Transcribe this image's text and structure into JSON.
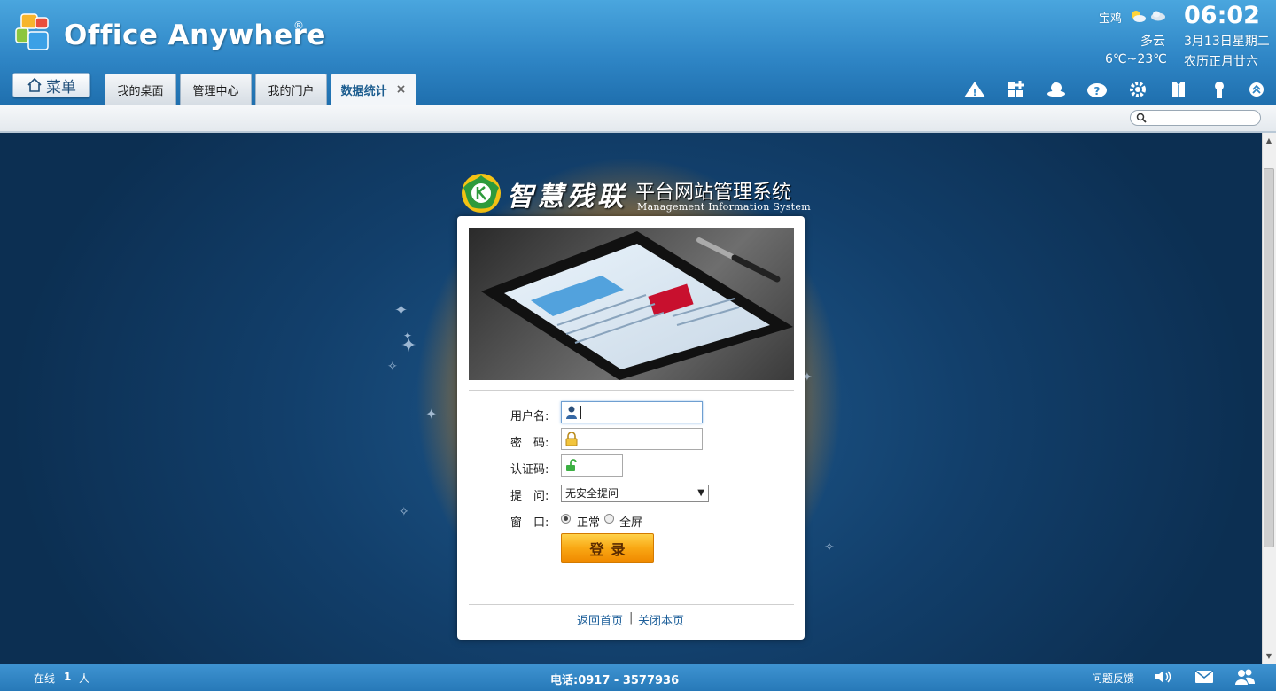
{
  "header": {
    "app_title": "Office Anywhere",
    "registered_mark": "®",
    "weather": {
      "city": "宝鸡",
      "condition": "多云",
      "temperature": "6℃~23℃",
      "time": "06:02",
      "date": "3月13日星期二",
      "lunar_date": "农历正月廿六"
    },
    "menu_label": "菜单",
    "tabs": [
      {
        "label": "我的桌面",
        "active": false
      },
      {
        "label": "管理中心",
        "active": false
      },
      {
        "label": "我的门户",
        "active": false
      },
      {
        "label": "数据统计",
        "active": true
      }
    ],
    "tab_close": "×",
    "toolbar_icons": [
      "warning-icon",
      "add-module-icon",
      "online-status-icon",
      "help-icon",
      "settings-icon",
      "theme-icon",
      "personal-icon",
      "collapse-icon"
    ]
  },
  "search": {
    "placeholder": ""
  },
  "login": {
    "brand_cn": "智慧残联",
    "brand_title": "平台网站管理系统",
    "brand_en": "Management Information System",
    "labels": {
      "username": "用户名:",
      "password": "密　码:",
      "captcha": "认证码:",
      "question": "提　问:",
      "window": "窗　口:"
    },
    "username_value": "",
    "password_value": "",
    "captcha_value": "",
    "question_selected": "无安全提问",
    "window_options": [
      {
        "label": "正常",
        "selected": true
      },
      {
        "label": "全屏",
        "selected": false
      }
    ],
    "login_button": "登录",
    "links": {
      "home": "返回首页",
      "separator": "|",
      "close": "关闭本页"
    }
  },
  "footer": {
    "online_prefix": "在线",
    "online_count": "1",
    "online_unit": "人",
    "phone": "电话:0917 - 3577936",
    "feedback": "问题反馈"
  },
  "colors": {
    "header_blue": "#2f86c6",
    "login_orange": "#f9a814",
    "link_blue": "#1d5f9a"
  }
}
